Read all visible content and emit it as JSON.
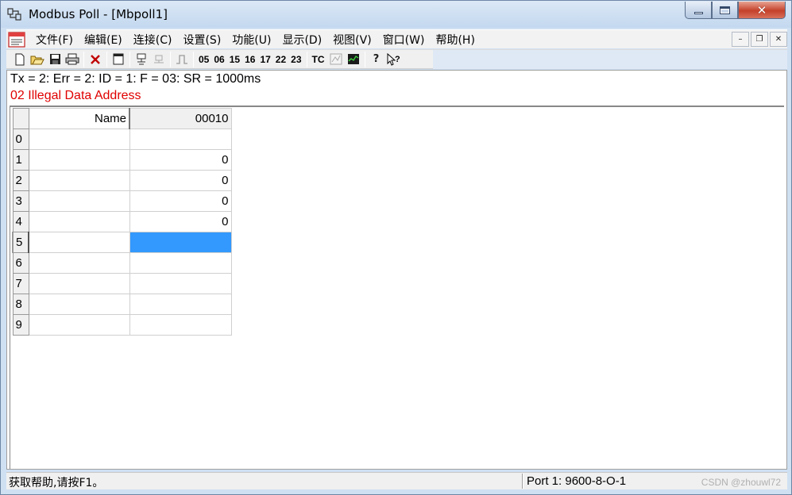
{
  "window": {
    "title": "Modbus Poll - [Mbpoll1]"
  },
  "menu": {
    "items": [
      "文件(F)",
      "编辑(E)",
      "连接(C)",
      "设置(S)",
      "功能(U)",
      "显示(D)",
      "视图(V)",
      "窗口(W)",
      "帮助(H)"
    ]
  },
  "toolbar": {
    "function_codes": [
      "05",
      "06",
      "15",
      "16",
      "17",
      "22",
      "23"
    ],
    "tc_label": "TC",
    "icons": [
      "new-icon",
      "open-icon",
      "save-icon",
      "print-icon",
      "delete-icon",
      "window-icon",
      "connect-icon",
      "disconnect-icon",
      "pulse-icon",
      "traffic-icon",
      "chart-icon",
      "help-icon",
      "context-help-icon"
    ]
  },
  "status": {
    "line": "Tx = 2: Err = 2: ID = 1: F = 03: SR = 1000ms",
    "error": "02 Illegal Data Address"
  },
  "grid": {
    "header_name": "Name",
    "header_address": "00010",
    "rows": [
      {
        "index": "0",
        "name": "",
        "value": ""
      },
      {
        "index": "1",
        "name": "",
        "value": "0"
      },
      {
        "index": "2",
        "name": "",
        "value": "0"
      },
      {
        "index": "3",
        "name": "",
        "value": "0"
      },
      {
        "index": "4",
        "name": "",
        "value": "0"
      },
      {
        "index": "5",
        "name": "",
        "value": ""
      },
      {
        "index": "6",
        "name": "",
        "value": ""
      },
      {
        "index": "7",
        "name": "",
        "value": ""
      },
      {
        "index": "8",
        "name": "",
        "value": ""
      },
      {
        "index": "9",
        "name": "",
        "value": ""
      }
    ],
    "selected_row": "5",
    "selection_color": "#3399ff"
  },
  "statusbar": {
    "help": "获取帮助,请按F1。",
    "port": "Port 1: 9600-8-O-1"
  },
  "watermark": "CSDN @zhouwl72"
}
